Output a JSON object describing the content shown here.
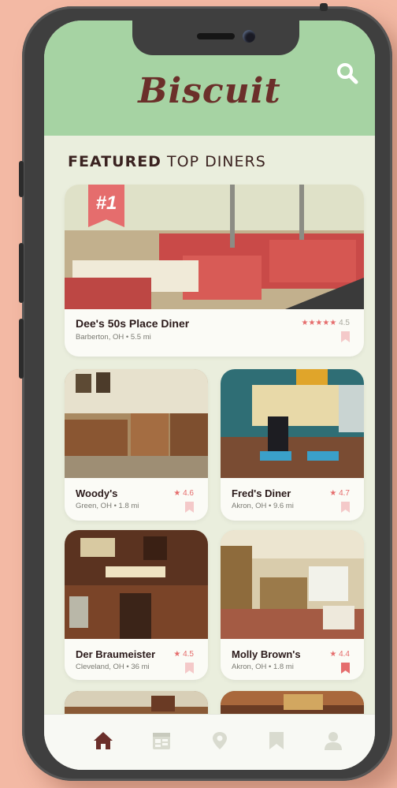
{
  "app": {
    "brand": "Biscuit",
    "colors": {
      "header": "#a6d3a3",
      "accent": "#e56d6d",
      "brand": "#6b2f2a",
      "background": "#eaeedd"
    }
  },
  "section": {
    "title_bold": "FEATURED",
    "title_rest": "TOP DINERS"
  },
  "featured": {
    "badge": "#1",
    "name": "Dee's 50s Place Diner",
    "location": "Barberton, OH • 5.5 mi",
    "stars": "★★★★★",
    "rating": "4.5",
    "bookmarked": false
  },
  "diners": [
    {
      "name": "Woody's",
      "location": "Green, OH • 1.8 mi",
      "rating": "★ 4.6",
      "bookmarked": false
    },
    {
      "name": "Fred's Diner",
      "location": "Akron, OH • 9.6 mi",
      "rating": "★ 4.7",
      "bookmarked": false
    },
    {
      "name": "Der Braumeister",
      "location": "Cleveland, OH • 36 mi",
      "rating": "★ 4.5",
      "bookmarked": false
    },
    {
      "name": "Molly Brown's",
      "location": "Akron, OH • 1.8 mi",
      "rating": "★ 4.4",
      "bookmarked": true
    }
  ],
  "tabs": [
    {
      "icon": "home-icon",
      "active": true
    },
    {
      "icon": "calendar-icon",
      "active": false
    },
    {
      "icon": "location-pin-icon",
      "active": false
    },
    {
      "icon": "bookmark-icon",
      "active": false
    },
    {
      "icon": "profile-icon",
      "active": false
    }
  ]
}
